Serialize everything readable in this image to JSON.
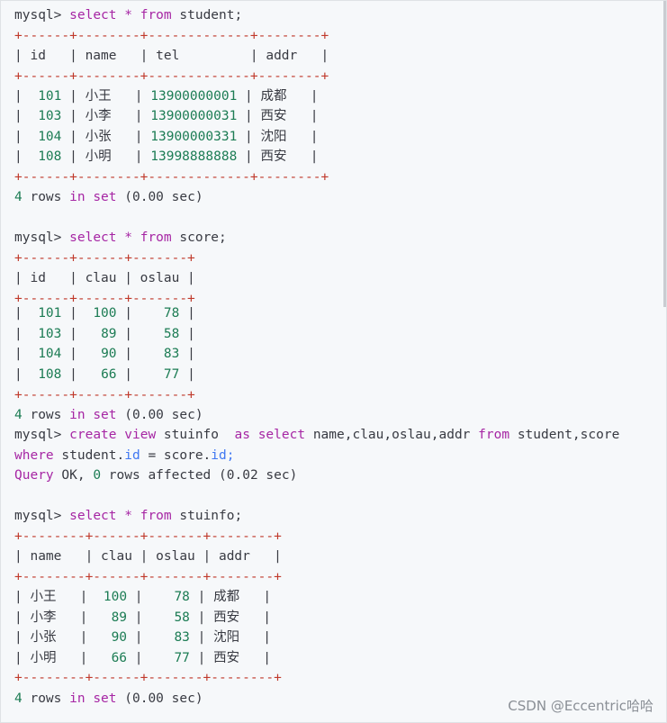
{
  "query1": {
    "prompt": "mysql>",
    "cmd_select": "select",
    "star": "*",
    "cmd_from": "from",
    "table": "student;",
    "border": "+------+--------+-------------+--------+",
    "header": "| id   | name   | tel         | addr   |",
    "rows": [
      {
        "id": "101",
        "name": "小王",
        "tel": "13900000001",
        "addr": "成都"
      },
      {
        "id": "103",
        "name": "小李",
        "tel": "13900000031",
        "addr": "西安"
      },
      {
        "id": "104",
        "name": "小张",
        "tel": "13900000331",
        "addr": "沈阳"
      },
      {
        "id": "108",
        "name": "小明",
        "tel": "13998888888",
        "addr": "西安"
      }
    ],
    "result_count": "4",
    "result_rows": "rows",
    "result_in": "in",
    "result_set": "set",
    "result_time": "(0.00 sec)"
  },
  "query2": {
    "prompt": "mysql>",
    "cmd_select": "select",
    "star": "*",
    "cmd_from": "from",
    "table": "score;",
    "border": "+------+------+-------+",
    "header": "| id   | clau | oslau |",
    "rows": [
      {
        "id": "101",
        "clau": "100",
        "oslau": "78"
      },
      {
        "id": "103",
        "clau": "89",
        "oslau": "58"
      },
      {
        "id": "104",
        "clau": "90",
        "oslau": "83"
      },
      {
        "id": "108",
        "clau": "66",
        "oslau": "77"
      }
    ],
    "result_count": "4",
    "result_rows": "rows",
    "result_in": "in",
    "result_set": "set",
    "result_time": "(0.00 sec)"
  },
  "query3": {
    "prompt": "mysql>",
    "cmd_create": "create",
    "cmd_view": "view",
    "view_name": "stuinfo",
    "cmd_as": "as",
    "cmd_select": "select",
    "columns": "name,clau,oslau,addr",
    "cmd_from": "from",
    "tables": "student,score",
    "cmd_where": "where",
    "cond_left": "student.",
    "cond_left_id": "id",
    "cond_eq": "=",
    "cond_right": "score.",
    "cond_right_id": "id;",
    "ok_query": "Query",
    "ok_text": "OK,",
    "ok_zero": "0",
    "ok_rows": "rows affected",
    "ok_time": "(0.02 sec)"
  },
  "query4": {
    "prompt": "mysql>",
    "cmd_select": "select",
    "star": "*",
    "cmd_from": "from",
    "table": "stuinfo;",
    "border": "+--------+------+-------+--------+",
    "header": "| name   | clau | oslau | addr   |",
    "rows": [
      {
        "name": "小王",
        "clau": "100",
        "oslau": "78",
        "addr": "成都"
      },
      {
        "name": "小李",
        "clau": "89",
        "oslau": "58",
        "addr": "西安"
      },
      {
        "name": "小张",
        "clau": "90",
        "oslau": "83",
        "addr": "沈阳"
      },
      {
        "name": "小明",
        "clau": "66",
        "oslau": "77",
        "addr": "西安"
      }
    ],
    "result_count": "4",
    "result_rows": "rows",
    "result_in": "in",
    "result_set": "set",
    "result_time": "(0.00 sec)"
  },
  "watermark": "CSDN @Eccentric哈哈"
}
